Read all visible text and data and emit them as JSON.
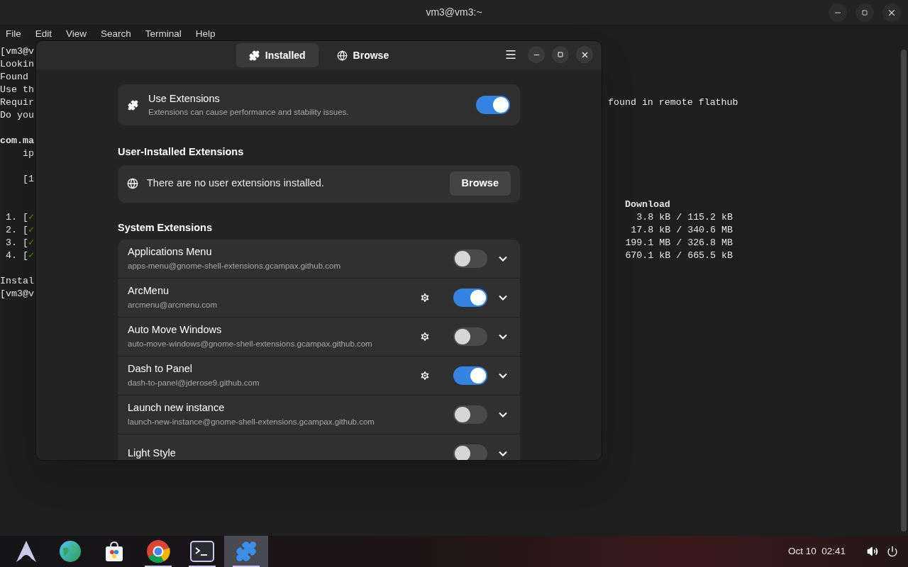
{
  "terminal": {
    "title": "vm3@vm3:~",
    "menu": [
      "File",
      "Edit",
      "View",
      "Search",
      "Terminal",
      "Help"
    ],
    "lines": [
      {
        "left": "[vm3@v"
      },
      {
        "left": "Lookin"
      },
      {
        "left": "Found"
      },
      {
        "left": "Use th"
      },
      {
        "left": "Requir",
        "right": "found in remote flathub",
        "kind": "message"
      },
      {
        "left": "Do you"
      },
      {
        "left": "com.ma",
        "bold": true,
        "blank_before": true
      },
      {
        "left": "ip",
        "indent": true
      },
      {
        "left": "[1",
        "indent": true,
        "blank_before": true
      },
      {
        "right": "Download",
        "kind": "heading",
        "blank_before": true
      },
      {
        "left": "1. [",
        "mark": "✓",
        "right": "3.8 kB / 115.2 kB",
        "kind": "size"
      },
      {
        "left": "2. [",
        "mark": "✓",
        "right": "17.8 kB / 340.6 MB",
        "kind": "size"
      },
      {
        "left": "3. [",
        "mark": "✓",
        "right": "199.1 MB / 326.8 MB",
        "kind": "size"
      },
      {
        "left": "4. [",
        "mark": "✓",
        "right": "670.1 kB / 665.5 kB",
        "kind": "size"
      },
      {
        "left": "Instal",
        "blank_before": true
      },
      {
        "left": "[vm3@v"
      }
    ]
  },
  "extensions_window": {
    "tabs": [
      {
        "label": "Installed",
        "selected": true
      },
      {
        "label": "Browse",
        "selected": false
      }
    ],
    "use_extensions": {
      "title": "Use Extensions",
      "subtitle": "Extensions can cause performance and stability issues.",
      "on": true
    },
    "user_section": {
      "heading": "User-Installed Extensions",
      "message": "There are no user extensions installed.",
      "button": "Browse"
    },
    "system_section": {
      "heading": "System Extensions",
      "items": [
        {
          "name": "Applications Menu",
          "id": "apps-menu@gnome-shell-extensions.gcampax.github.com",
          "has_settings": false,
          "on": false
        },
        {
          "name": "ArcMenu",
          "id": "arcmenu@arcmenu.com",
          "has_settings": true,
          "on": true
        },
        {
          "name": "Auto Move Windows",
          "id": "auto-move-windows@gnome-shell-extensions.gcampax.github.com",
          "has_settings": true,
          "on": false
        },
        {
          "name": "Dash to Panel",
          "id": "dash-to-panel@jderose9.github.com",
          "has_settings": true,
          "on": true
        },
        {
          "name": "Launch new instance",
          "id": "launch-new-instance@gnome-shell-extensions.gcampax.github.com",
          "has_settings": false,
          "on": false
        },
        {
          "name": "Light Style",
          "has_settings": false,
          "on": false
        }
      ]
    }
  },
  "taskbar": {
    "apps": [
      {
        "kind": "launcher",
        "running": false,
        "selected": false
      },
      {
        "kind": "globe",
        "running": false,
        "selected": false
      },
      {
        "kind": "store",
        "running": false,
        "selected": false
      },
      {
        "kind": "browser",
        "running": true,
        "selected": false
      },
      {
        "kind": "terminal",
        "running": true,
        "selected": false
      },
      {
        "kind": "extensions",
        "running": true,
        "selected": true
      }
    ],
    "date": "Oct 10",
    "time": "02:41"
  }
}
